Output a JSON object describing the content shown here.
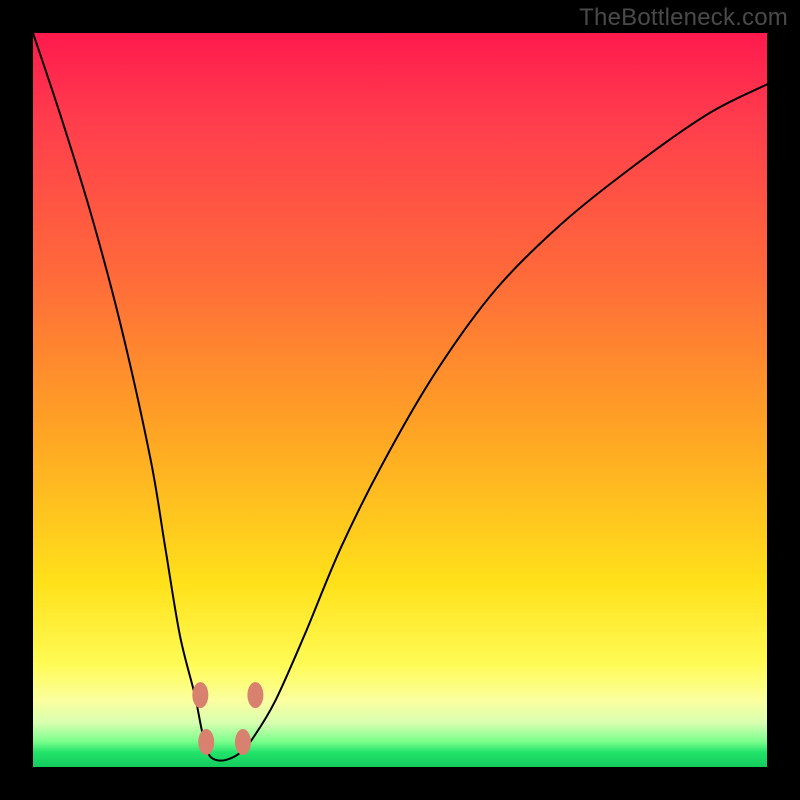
{
  "watermark": "TheBottleneck.com",
  "chart_data": {
    "type": "line",
    "title": "",
    "xlabel": "",
    "ylabel": "",
    "xlim": [
      0,
      100
    ],
    "ylim": [
      0,
      100
    ],
    "grid": false,
    "legend": false,
    "series": [
      {
        "name": "bottleneck-curve",
        "x": [
          0,
          4,
          8,
          12,
          16,
          18,
          20,
          22,
          23,
          23.8,
          24.8,
          26.4,
          28.3,
          30.0,
          33,
          37,
          42,
          48,
          55,
          63,
          72,
          82,
          92,
          100
        ],
        "y": [
          100,
          88,
          75,
          60,
          42,
          30,
          18,
          10,
          5,
          2,
          1,
          1,
          2,
          4,
          9,
          18,
          30,
          42,
          54,
          65,
          74,
          82,
          89,
          93
        ]
      }
    ],
    "annotations": [
      {
        "name": "left-dot-upper",
        "x": 22.8,
        "y": 9.8
      },
      {
        "name": "left-dot-lower",
        "x": 23.6,
        "y": 3.4
      },
      {
        "name": "right-dot-lower",
        "x": 28.6,
        "y": 3.4
      },
      {
        "name": "right-dot-upper",
        "x": 30.3,
        "y": 9.8
      }
    ],
    "colors": {
      "gradient_top": "#ff1a4d",
      "gradient_mid": "#ffe11a",
      "gradient_bottom": "#13cc5d",
      "curve": "#000000",
      "annotation": "#d9816f"
    }
  }
}
